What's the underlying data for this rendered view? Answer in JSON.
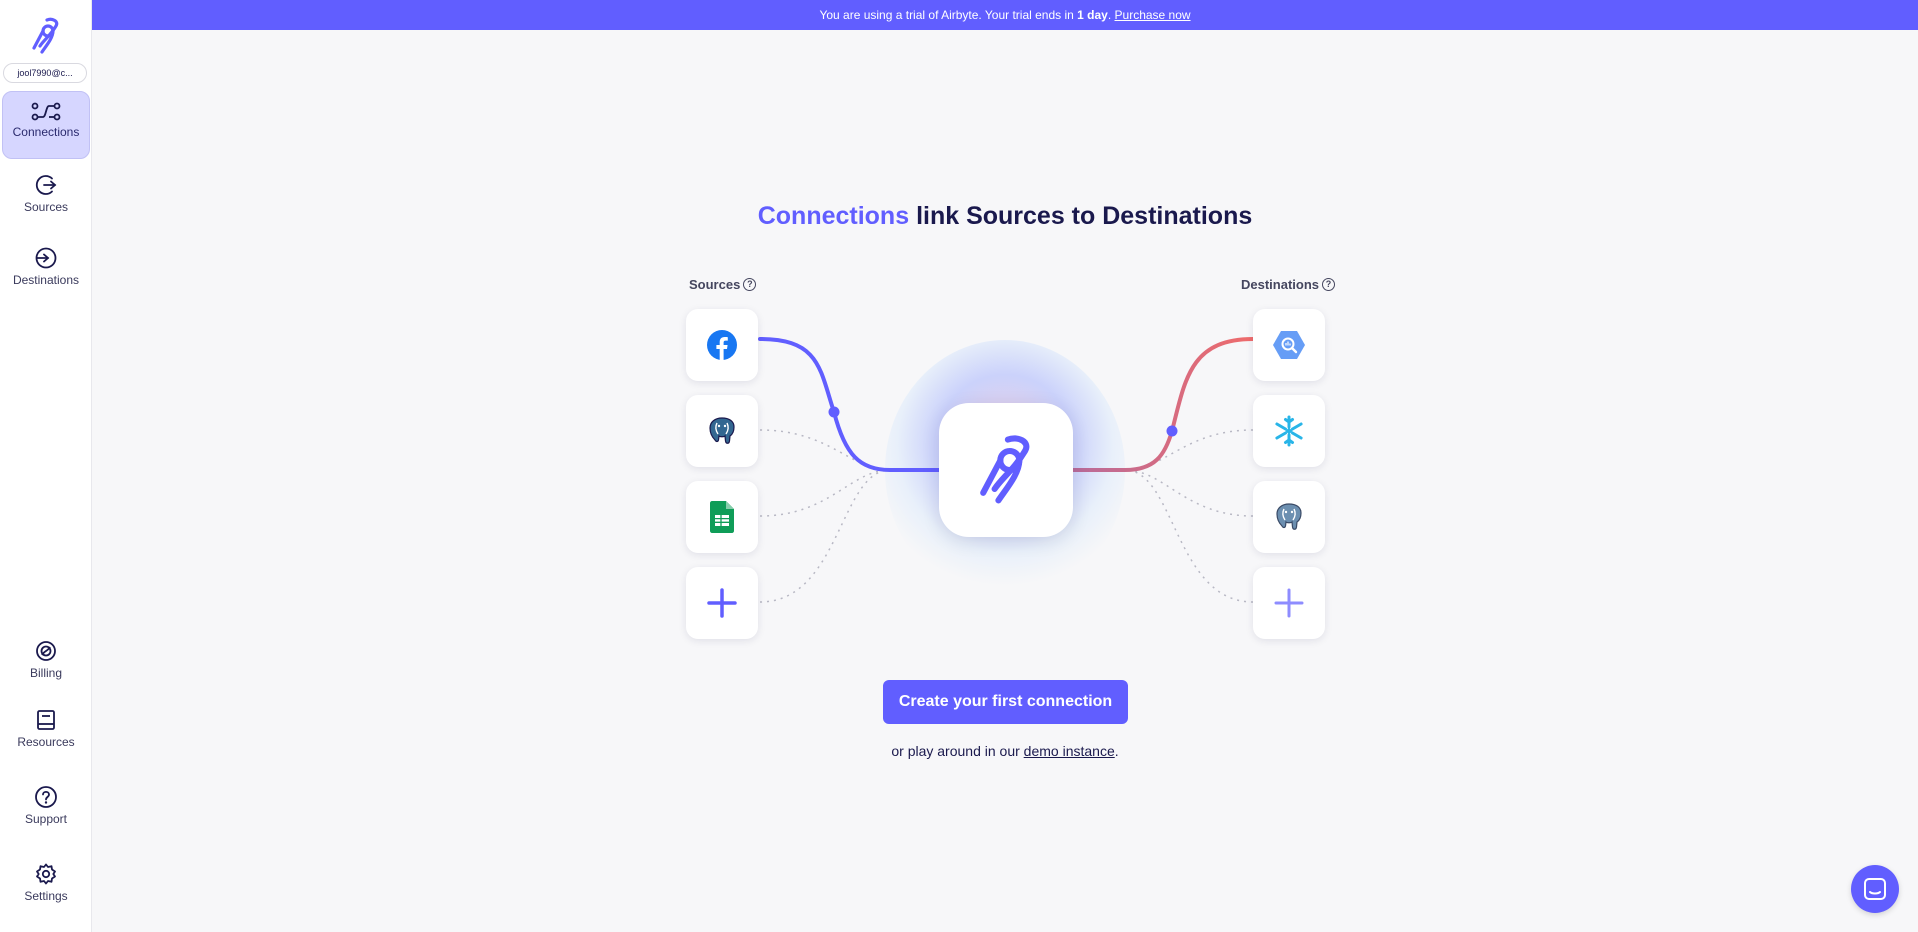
{
  "workspace": {
    "email": "jool7990@c..."
  },
  "sidebar": {
    "top_items": [
      {
        "label": "Connections",
        "icon": "connections-icon",
        "active": true
      },
      {
        "label": "Sources",
        "icon": "sources-icon"
      },
      {
        "label": "Destinations",
        "icon": "destinations-icon"
      }
    ],
    "bottom_items": [
      {
        "label": "Billing",
        "icon": "billing-icon"
      },
      {
        "label": "Resources",
        "icon": "resources-icon"
      },
      {
        "label": "Support",
        "icon": "support-icon"
      },
      {
        "label": "Settings",
        "icon": "settings-icon"
      }
    ]
  },
  "banner": {
    "prefix": "You are using a trial of Airbyte. Your trial ends in ",
    "bold": "1 day",
    "suffix": ". ",
    "link": "Purchase now"
  },
  "main": {
    "headline_accent": "Connections",
    "headline_rest": " link Sources to Destinations",
    "sources_label": "Sources",
    "destinations_label": "Destinations",
    "help_glyph": "?",
    "source_tiles": [
      "facebook-icon",
      "postgres-icon",
      "google-sheets-icon",
      "plus-icon"
    ],
    "destination_tiles": [
      "bigquery-icon",
      "snowflake-icon",
      "postgres-icon",
      "plus-icon"
    ],
    "cta_label": "Create your first connection",
    "sub_prefix": "or play around in our ",
    "sub_link": "demo instance",
    "sub_suffix": "."
  },
  "colors": {
    "brand": "#615eff",
    "destination_line": "#ef6b6b",
    "sidebar_active_bg": "#d6d6ff"
  }
}
